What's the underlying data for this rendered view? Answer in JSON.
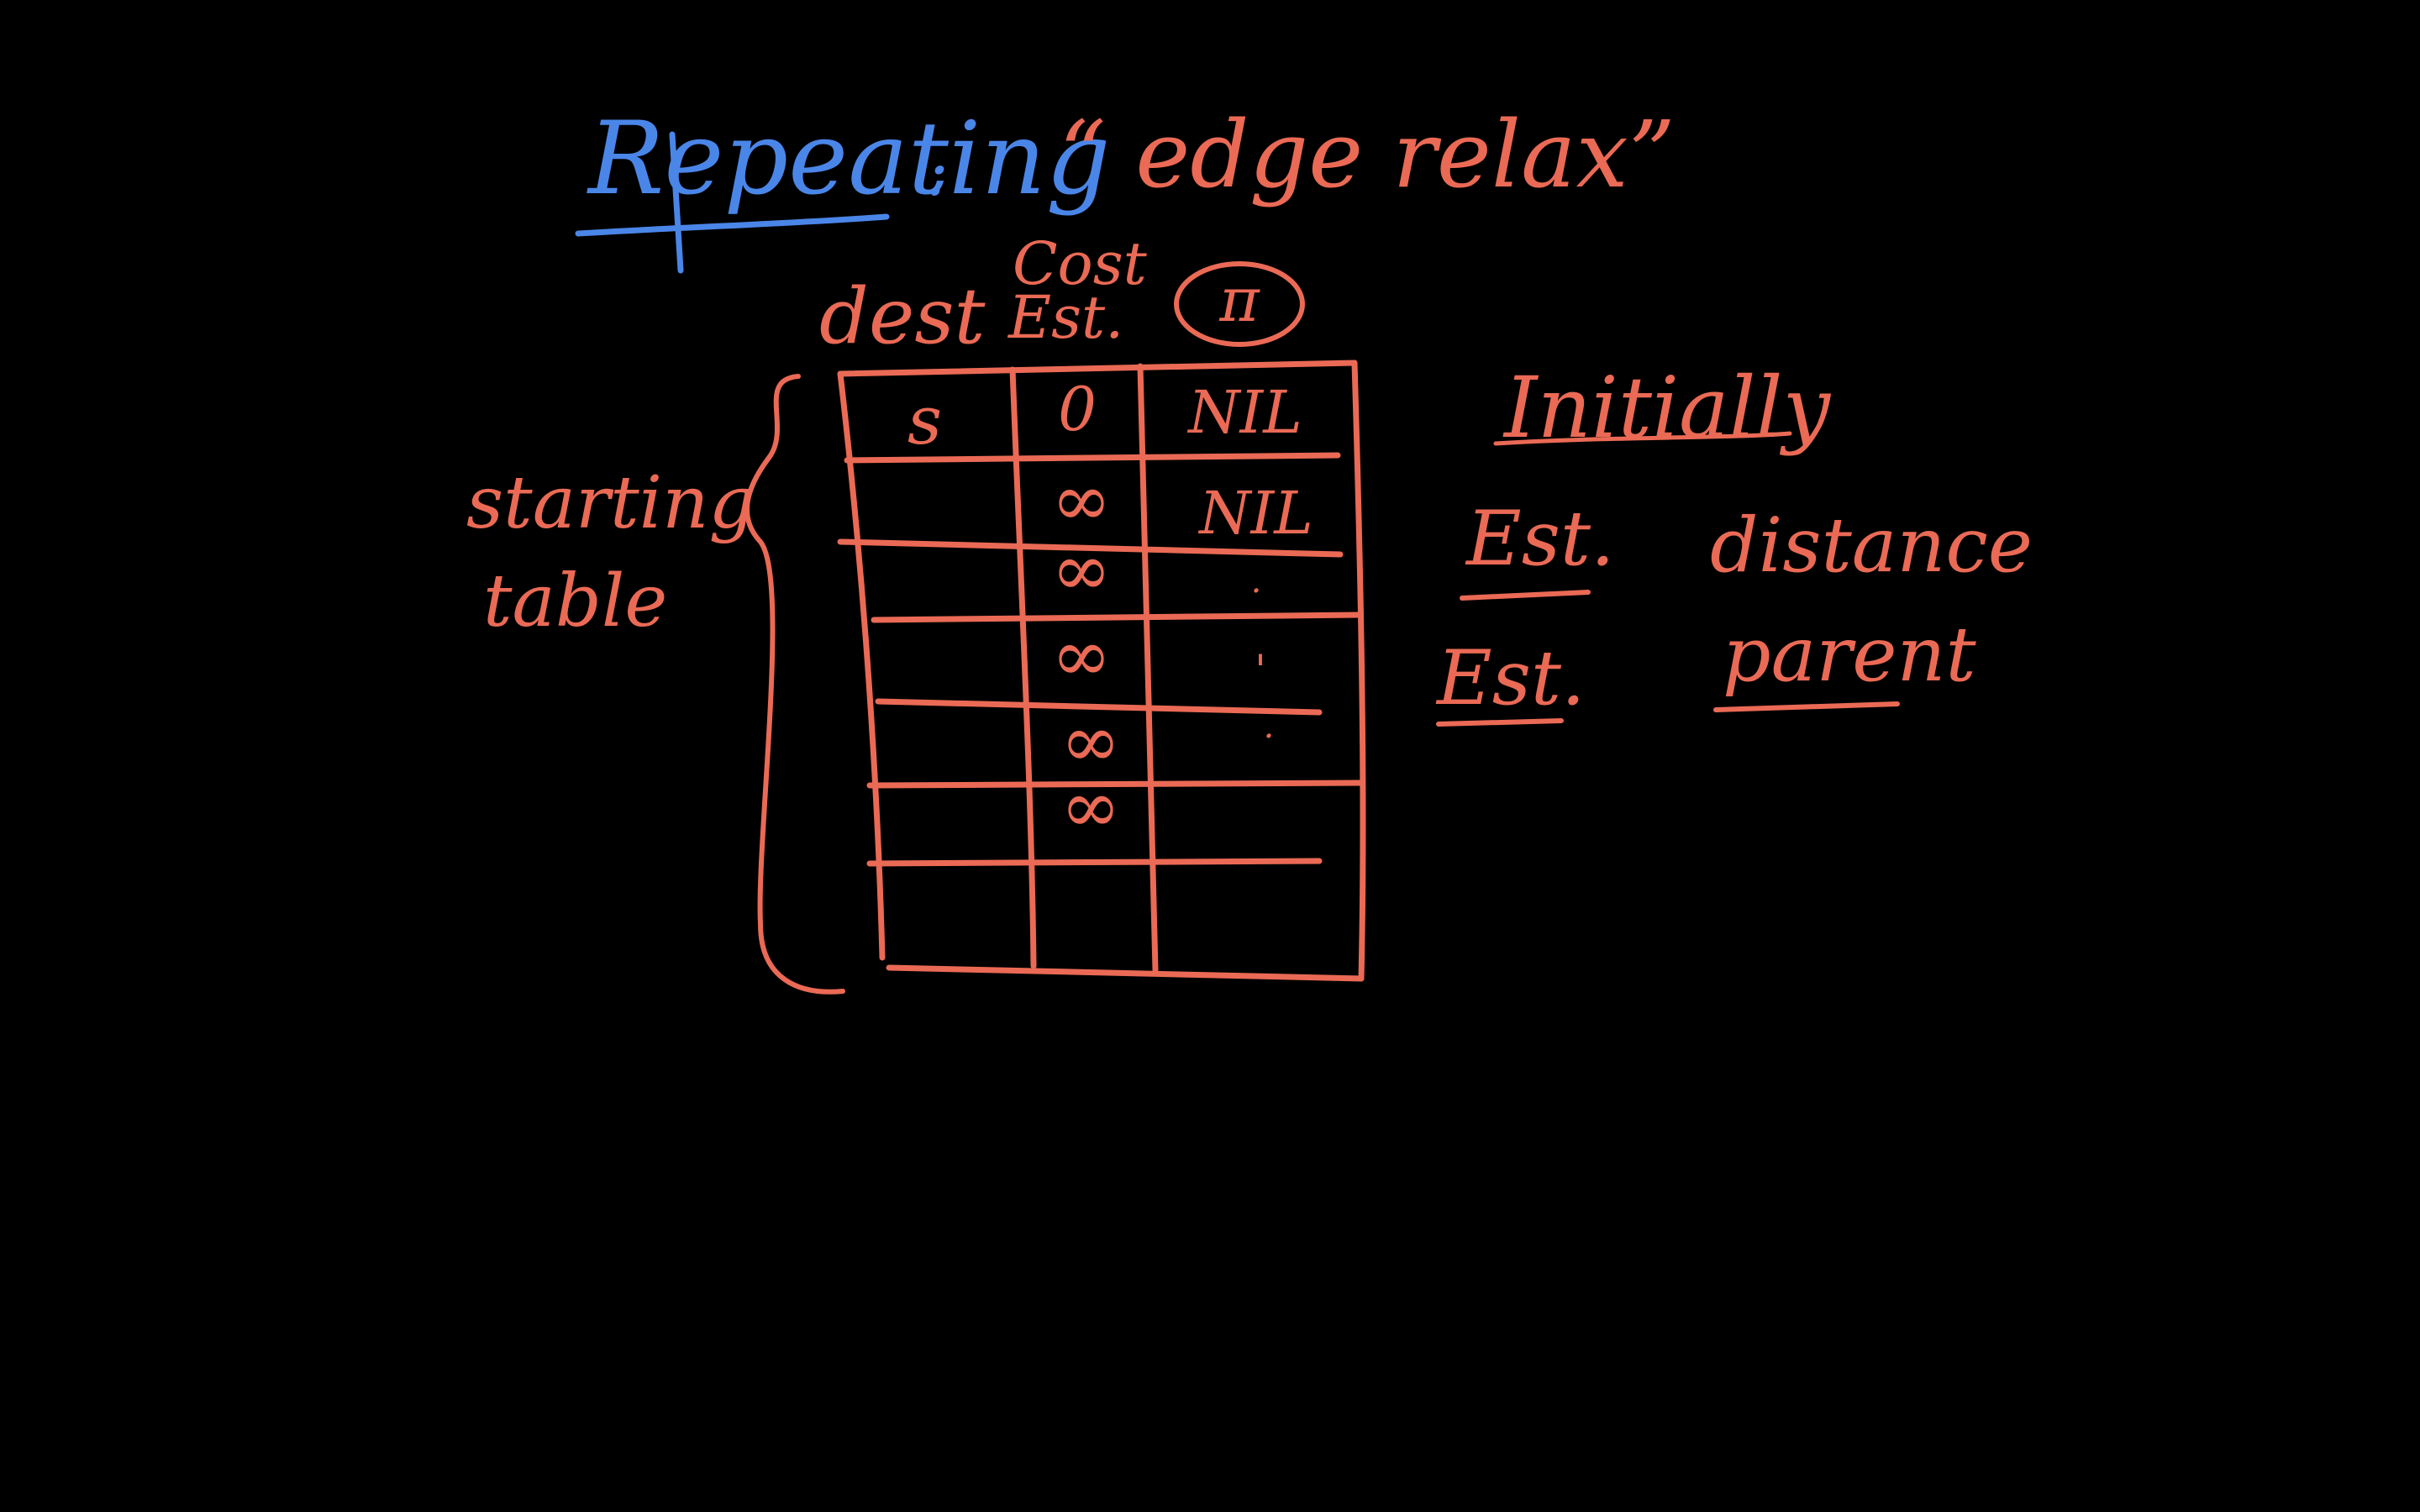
{
  "heading": {
    "left": "Repeating",
    "colon": ":",
    "right": "“ edge relax”"
  },
  "table": {
    "headers": {
      "dest": "dest",
      "cost_line1": "Cost",
      "cost_line2": "Est.",
      "parent": "π"
    },
    "rows": [
      {
        "dest": "s",
        "cost": "0",
        "parent": "NIL"
      },
      {
        "dest": "",
        "cost": "∞",
        "parent": "NIL"
      },
      {
        "dest": "",
        "cost": "∞",
        "parent": "."
      },
      {
        "dest": "",
        "cost": "∞",
        "parent": "'"
      },
      {
        "dest": "",
        "cost": "∞",
        "parent": "."
      },
      {
        "dest": "",
        "cost": "∞",
        "parent": ""
      },
      {
        "dest": "",
        "cost": "",
        "parent": ""
      }
    ]
  },
  "side_label": {
    "line1": "starting",
    "line2": "table"
  },
  "notes": {
    "initially": "Initially",
    "row1_left": "Est.",
    "row1_right": "distance",
    "row2_left": "Est.",
    "row2_right": "parent"
  },
  "colors": {
    "background": "#000000",
    "blue_ink": "#4a86e8",
    "red_ink": "#ea6a55"
  }
}
